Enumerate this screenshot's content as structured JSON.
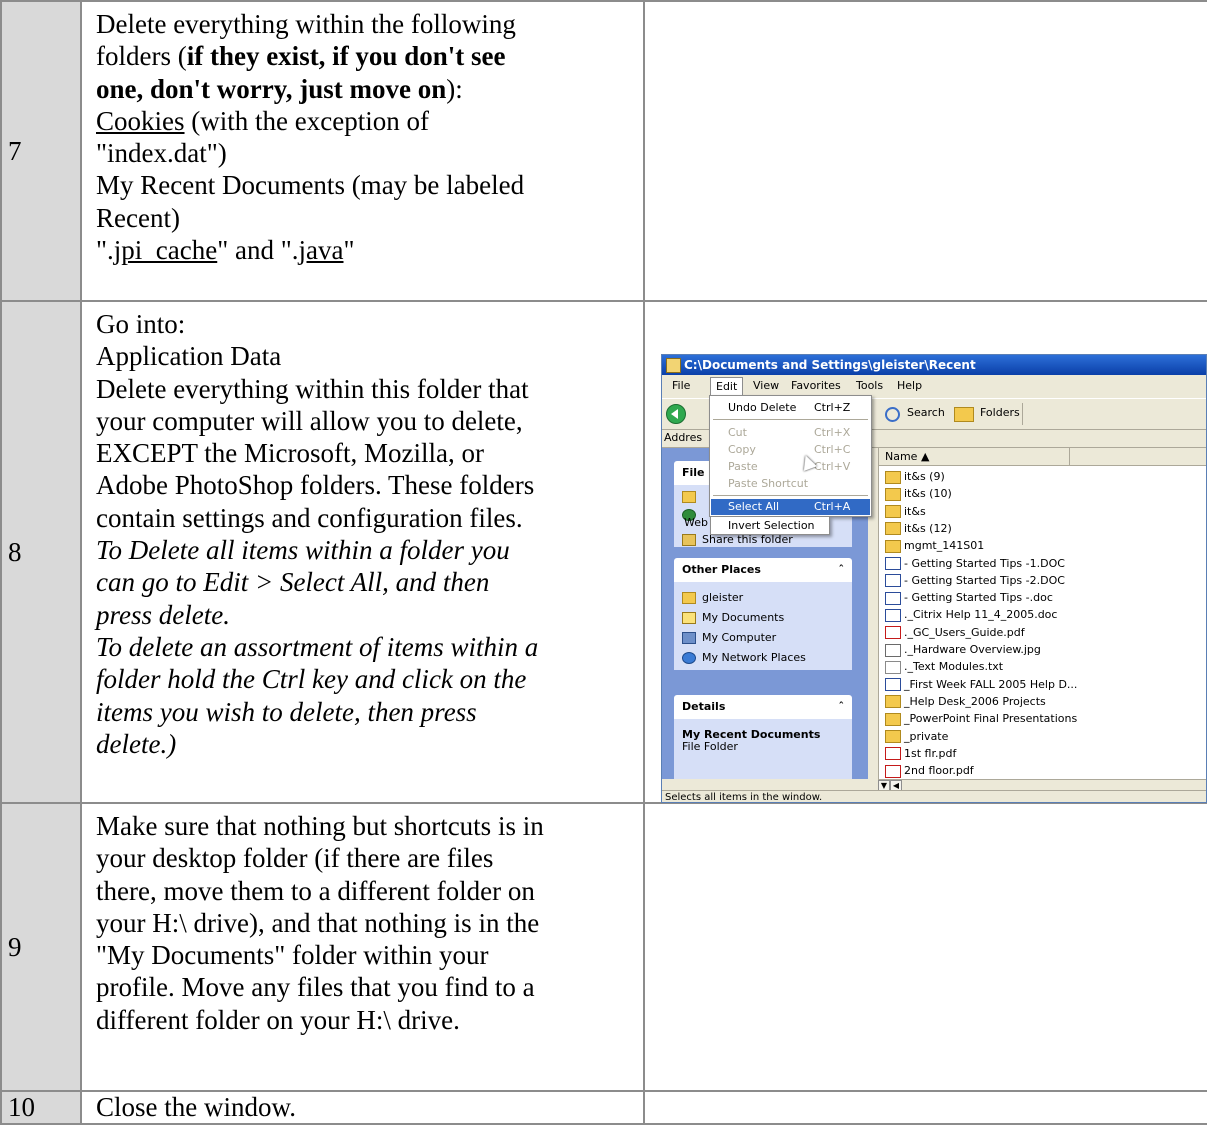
{
  "rows": [
    {
      "num": "7",
      "lines": {
        "l1": "Delete everything within the following",
        "l2a": "folders (",
        "l2b": "if they exist, if you don't see",
        "l3a": "one, don't worry, just move on",
        "l3b": "):",
        "l4a": "Cookies",
        "l4b": " (with the exception of",
        "l5": "\"index.dat\")",
        "l6": "My Recent Documents (may be labeled",
        "l7": "Recent)",
        "l8a": "\".",
        "l8b": "jpi_cache",
        "l8c": "\" and \".",
        "l8d": "java",
        "l8e": "\""
      }
    },
    {
      "num": "8",
      "lines": {
        "l1": "Go into:",
        "l2": "Application Data",
        "l3": "Delete everything within this folder that",
        "l4": "your computer will allow you to delete,",
        "l5": "EXCEPT the Microsoft, Mozilla, or",
        "l6": "Adobe PhotoShop folders. These folders",
        "l7": "contain settings and configuration files.",
        "l8": "To Delete all items within a folder you",
        "l9": "can go to Edit > Select All, and then",
        "l10": "press delete.",
        "l11": "To delete an assortment of items within a",
        "l12": "folder hold the Ctrl key and click on the",
        "l13": "items you wish to delete, then press",
        "l14": "delete.)"
      }
    },
    {
      "num": "9",
      "lines": {
        "l1": "Make sure that nothing but shortcuts is in",
        "l2": "your desktop folder (if there are files",
        "l3": "there, move them to a different folder on",
        "l4": "your H:\\ drive), and that nothing is in the",
        "l5": "\"My Documents\" folder within your",
        "l6": "profile. Move any files that you find to a",
        "l7": "different folder on your H:\\ drive."
      }
    },
    {
      "num": "10",
      "lines": {
        "l1": "Close the window."
      }
    }
  ],
  "screenshot": {
    "title": "C:\\Documents and Settings\\gleister\\Recent",
    "menubar": [
      "File",
      "Edit",
      "View",
      "Favorites",
      "Tools",
      "Help"
    ],
    "toolbar": {
      "search": "Search",
      "folders": "Folders"
    },
    "address_label": "Addres",
    "edit_menu": {
      "items": [
        {
          "label": "Undo Delete",
          "shortcut": "Ctrl+Z",
          "enabled": true
        },
        {
          "label": "Cut",
          "shortcut": "Ctrl+X",
          "enabled": false
        },
        {
          "label": "Copy",
          "shortcut": "Ctrl+C",
          "enabled": false
        },
        {
          "label": "Paste",
          "shortcut": "Ctrl+V",
          "enabled": false
        },
        {
          "label": "Paste Shortcut",
          "shortcut": "",
          "enabled": false
        },
        {
          "label": "Select All",
          "shortcut": "Ctrl+A",
          "enabled": true,
          "selected": true
        },
        {
          "label": "Invert Selection",
          "shortcut": "",
          "enabled": true
        }
      ]
    },
    "file_tasks": {
      "head": "File",
      "items": [
        "Web",
        "Share this folder"
      ]
    },
    "other_places": {
      "head": "Other Places",
      "items": [
        "gleister",
        "My Documents",
        "My Computer",
        "My Network Places"
      ]
    },
    "details": {
      "head": "Details",
      "name": "My Recent Documents",
      "type": "File Folder"
    },
    "column_name": "Name",
    "files": [
      {
        "name": "it&s (9)",
        "icon": "folder-icon"
      },
      {
        "name": "it&s (10)",
        "icon": "folder-icon"
      },
      {
        "name": "it&s",
        "icon": "folder-icon"
      },
      {
        "name": "it&s (12)",
        "icon": "folder-icon"
      },
      {
        "name": "mgmt_141S01",
        "icon": "folder-icon"
      },
      {
        "name": "- Getting Started Tips -1.DOC",
        "icon": "word-doc-icon"
      },
      {
        "name": "- Getting Started Tips -2.DOC",
        "icon": "word-doc-icon"
      },
      {
        "name": "- Getting Started Tips -.doc",
        "icon": "word-doc-icon"
      },
      {
        "name": "._Citrix Help 11_4_2005.doc",
        "icon": "word-doc-icon"
      },
      {
        "name": "._GC_Users_Guide.pdf",
        "icon": "pdf-icon"
      },
      {
        "name": "._Hardware Overview.jpg",
        "icon": "image-file-icon"
      },
      {
        "name": "._Text Modules.txt",
        "icon": "text-file-icon"
      },
      {
        "name": "_First Week FALL 2005 Help D...",
        "icon": "word-doc-icon"
      },
      {
        "name": "_Help Desk_2006 Projects",
        "icon": "folder-shortcut-icon"
      },
      {
        "name": "_PowerPoint Final Presentations",
        "icon": "folder-shortcut-icon"
      },
      {
        "name": "_private",
        "icon": "folder-shortcut-icon"
      },
      {
        "name": "1st flr.pdf",
        "icon": "pdf-icon"
      },
      {
        "name": "2nd floor.pdf",
        "icon": "pdf-icon"
      }
    ],
    "status": "Selects all items in the window."
  }
}
